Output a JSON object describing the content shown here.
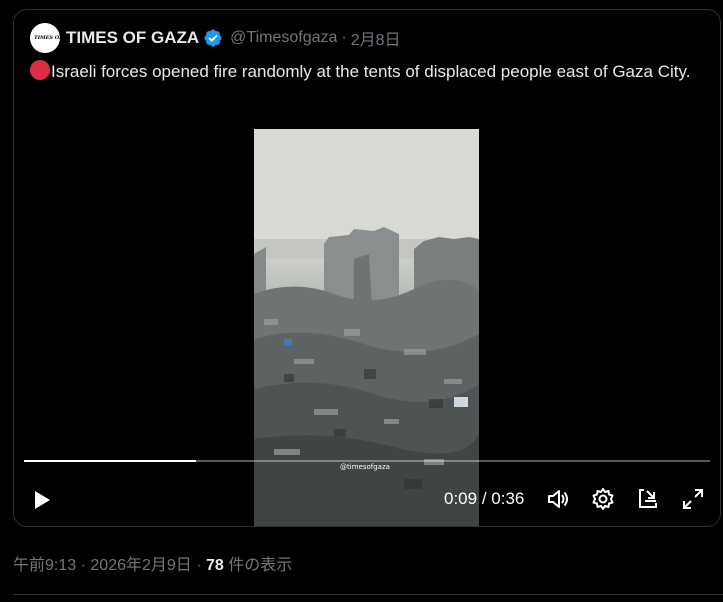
{
  "tweet": {
    "avatar_text": "TIMES OF GAZA",
    "display_name": "TIMES OF GAZA",
    "handle": "@Timesofgaza",
    "separator": "·",
    "date": "2月8日",
    "text": "Israeli forces opened fire randomly at the tents of displaced people east of Gaza City."
  },
  "video": {
    "current_time": "0:09",
    "time_separator": "/",
    "duration": "0:36",
    "progress_fraction": 0.25,
    "watermark": "@timesofgaza"
  },
  "meta": {
    "time": "午前9:13",
    "separator": "·",
    "date": "2026年2月9日",
    "separator2": "·",
    "views": "78",
    "views_suffix": "件の表示"
  },
  "colors": {
    "verified_blue": "#1d9bf0",
    "red_circle": "#dd2e44",
    "muted_text": "#71767b",
    "text": "#e7e9ea"
  },
  "icons": [
    "verified-badge-icon",
    "red-circle-icon",
    "play-icon",
    "volume-icon",
    "settings-gear-icon",
    "minimize-pip-icon",
    "fullscreen-icon"
  ]
}
